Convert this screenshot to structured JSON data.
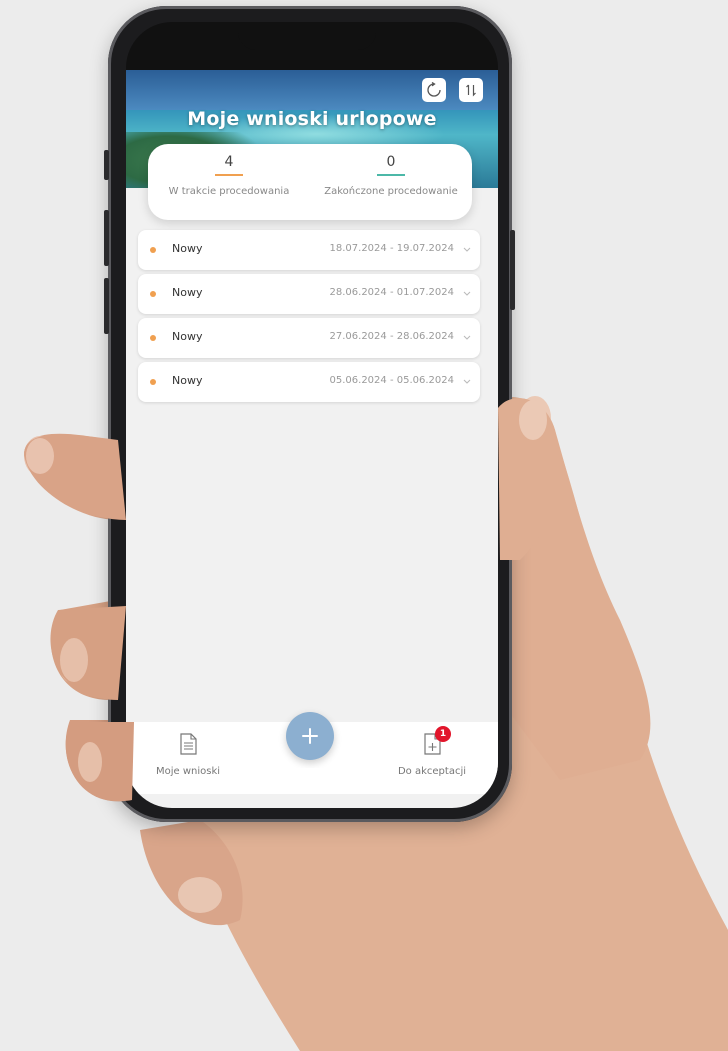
{
  "header": {
    "title": "Moje wnioski urlopowe",
    "refresh_icon": "refresh-icon",
    "sort_icon": "sort-icon"
  },
  "stats": [
    {
      "value": "4",
      "label": "W trakcie procedowania",
      "color": "#f0a050"
    },
    {
      "value": "0",
      "label": "Zakończone procedowanie",
      "color": "#4cb8a8"
    }
  ],
  "requests": [
    {
      "status": "Nowy",
      "dates": "18.07.2024 - 19.07.2024"
    },
    {
      "status": "Nowy",
      "dates": "28.06.2024 - 01.07.2024"
    },
    {
      "status": "Nowy",
      "dates": "27.06.2024 - 28.06.2024"
    },
    {
      "status": "Nowy",
      "dates": "05.06.2024 - 05.06.2024"
    }
  ],
  "tabbar": {
    "my_requests_label": "Moje wnioski",
    "to_accept_label": "Do akceptacji",
    "to_accept_badge": "1",
    "fab_label": "+"
  },
  "colors": {
    "status_dot": "#f0a050",
    "fab": "#8cafd0",
    "badge": "#e2152b"
  }
}
